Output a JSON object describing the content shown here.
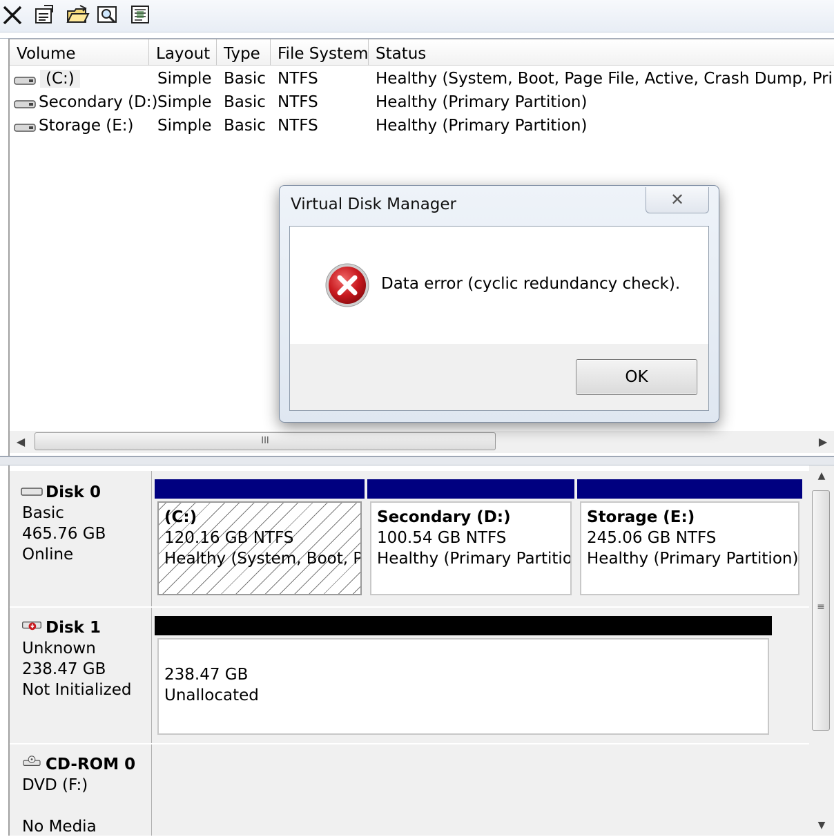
{
  "toolbar": {
    "buttons": [
      {
        "name": "delete-icon"
      },
      {
        "name": "properties-icon"
      },
      {
        "name": "open-folder-icon"
      },
      {
        "name": "explore-icon"
      },
      {
        "name": "help-icon"
      }
    ]
  },
  "volume_list": {
    "columns": [
      "Volume",
      "Layout",
      "Type",
      "File System",
      "Status"
    ],
    "rows": [
      {
        "volume": "(C:)",
        "layout": "Simple",
        "type": "Basic",
        "fs": "NTFS",
        "status": "Healthy (System, Boot, Page File, Active, Crash Dump, Primary"
      },
      {
        "volume": "Secondary (D:)",
        "layout": "Simple",
        "type": "Basic",
        "fs": "NTFS",
        "status": "Healthy (Primary Partition)"
      },
      {
        "volume": "Storage (E:)",
        "layout": "Simple",
        "type": "Basic",
        "fs": "NTFS",
        "status": "Healthy (Primary Partition)"
      }
    ],
    "hscroll_grip": "III"
  },
  "disks": [
    {
      "title": "Disk 0",
      "kind": "Basic",
      "size": "465.76 GB",
      "state": "Online",
      "partitions": [
        {
          "name": "(C:)",
          "size": "120.16 GB NTFS",
          "status": "Healthy (System, Boot, Pa"
        },
        {
          "name": "Secondary  (D:)",
          "size": "100.54 GB NTFS",
          "status": "Healthy (Primary Partition"
        },
        {
          "name": "Storage  (E:)",
          "size": "245.06 GB NTFS",
          "status": "Healthy (Primary Partition)"
        }
      ]
    },
    {
      "title": "Disk 1",
      "kind": "Unknown",
      "size": "238.47 GB",
      "state": "Not Initialized",
      "partitions": [
        {
          "size": "238.47 GB",
          "status": "Unallocated"
        }
      ]
    },
    {
      "title": "CD-ROM 0",
      "kind": "DVD (F:)",
      "state": "No Media"
    }
  ],
  "vscroll_grip": "≡",
  "dialog": {
    "title": "Virtual Disk Manager",
    "close_glyph": "✕",
    "message": "Data error (cyclic redundancy check).",
    "ok_label": "OK"
  },
  "colors": {
    "partition_bar_primary": "#000080",
    "partition_bar_unallocated": "#000000",
    "error_red": "#c8191e"
  }
}
